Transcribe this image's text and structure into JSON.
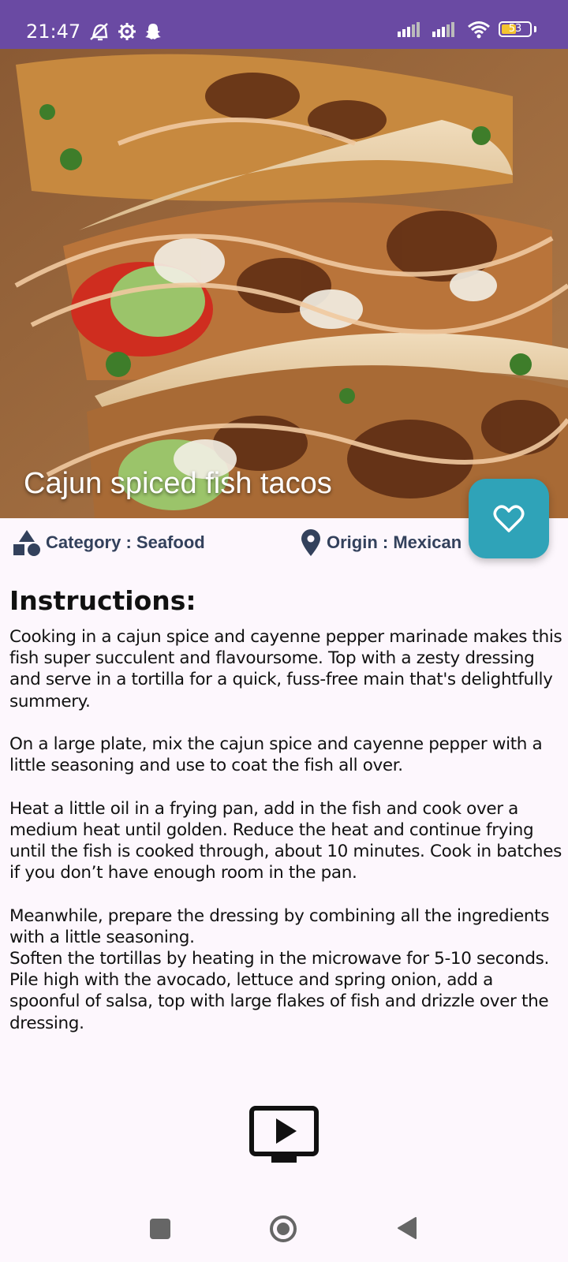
{
  "status_bar": {
    "time": "21:47",
    "battery": "53",
    "icons_left": [
      "mute-alarm-icon",
      "settings-icon",
      "snapchat-icon"
    ],
    "icons_right": [
      "signal-icon",
      "signal-icon",
      "wifi-icon",
      "battery-icon"
    ],
    "color": "#6a4aa3"
  },
  "hero": {
    "title": "Cajun spiced fish tacos",
    "image": "fish-tacos-photo"
  },
  "favorite_button": {
    "icon": "heart-icon",
    "color": "#2fa3b8"
  },
  "meta": {
    "category_label": "Category : Seafood",
    "category_icon": "shapes-icon",
    "origin_label": "Origin : Mexican",
    "origin_icon": "location-pin-icon"
  },
  "instructions": {
    "title": "Instructions:",
    "text": "Cooking in a cajun spice and cayenne pepper marinade makes this fish super succulent and flavoursome. Top with a zesty dressing and serve in a tortilla for a quick, fuss-free main that's delightfully summery.\n\nOn a large plate, mix the cajun spice and cayenne pepper with a little seasoning and use to coat the fish all over.\n\nHeat a little oil in a frying pan, add in the fish and cook over a medium heat until golden. Reduce the heat and continue frying until the fish is cooked through, about 10 minutes. Cook in batches if you don’t have enough room in the pan.\n\nMeanwhile, prepare the dressing by combining all the ingredients with a little seasoning.\nSoften the tortillas by heating in the microwave for 5-10 seconds. Pile high with the avocado, lettuce and spring onion, add a spoonful of salsa, top with large flakes of fish and drizzle over the dressing."
  },
  "video_button": {
    "icon": "tv-play-icon"
  },
  "nav_bar": {
    "icons": [
      "recents-icon",
      "home-icon",
      "back-icon"
    ]
  }
}
